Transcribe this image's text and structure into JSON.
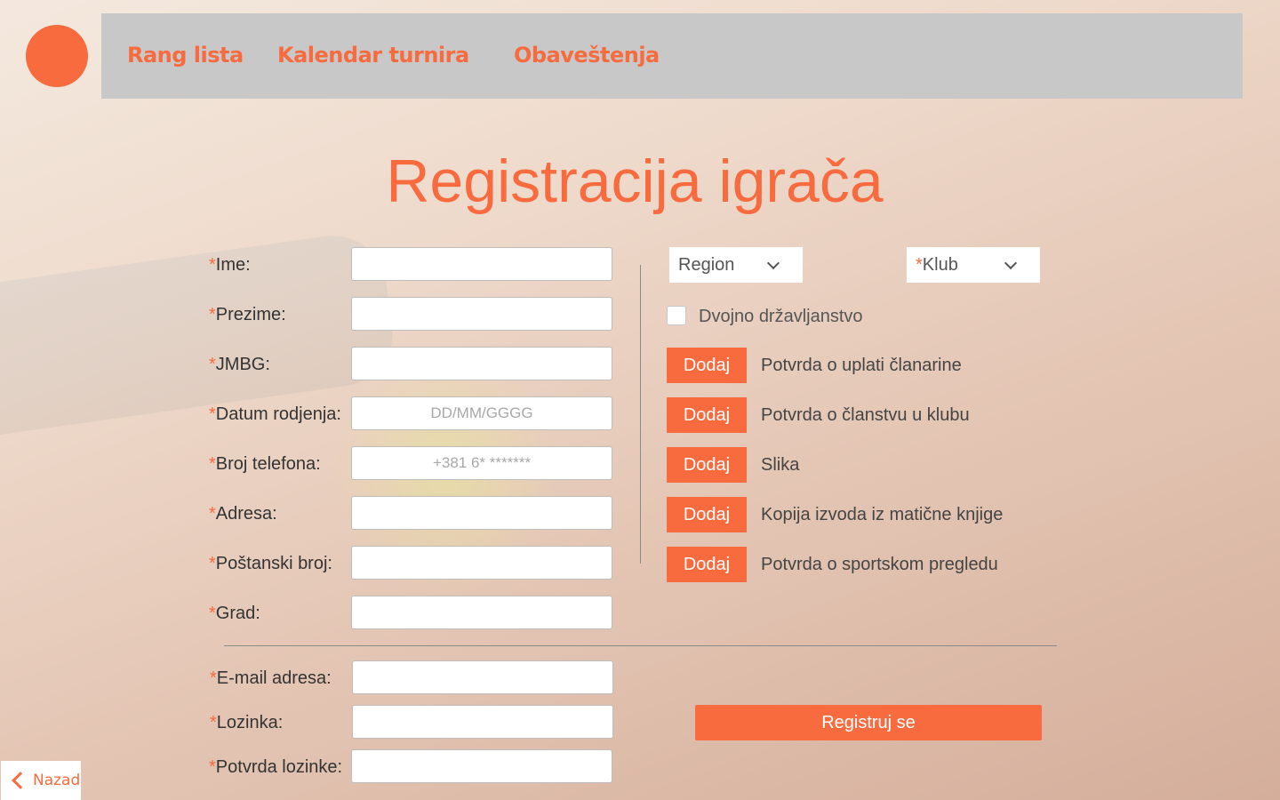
{
  "nav": {
    "items": [
      "Rang lista",
      "Kalendar turnira",
      "Obaveštenja"
    ]
  },
  "page": {
    "title": "Registracija igrača"
  },
  "form": {
    "required_marker": "*",
    "fields": [
      {
        "label": "Ime:",
        "value": "",
        "placeholder": ""
      },
      {
        "label": "Prezime:",
        "value": "",
        "placeholder": ""
      },
      {
        "label": "JMBG:",
        "value": "",
        "placeholder": ""
      },
      {
        "label": "Datum rodjenja:",
        "value": "",
        "placeholder": "DD/MM/GGGG"
      },
      {
        "label": "Broj telefona:",
        "value": "",
        "placeholder": "+381 6* *******"
      },
      {
        "label": "Adresa:",
        "value": "",
        "placeholder": ""
      },
      {
        "label": "Poštanski broj:",
        "value": "",
        "placeholder": ""
      },
      {
        "label": "Grad:",
        "value": "",
        "placeholder": ""
      }
    ],
    "account_fields": [
      {
        "label": "E-mail adresa:",
        "value": "",
        "placeholder": ""
      },
      {
        "label": "Lozinka:",
        "value": "",
        "placeholder": ""
      },
      {
        "label": "Potvrda lozinke:",
        "value": "",
        "placeholder": ""
      }
    ],
    "region_select": {
      "selected": "Region"
    },
    "club_select": {
      "selected": "Klub",
      "required": true
    },
    "dual_citizenship": {
      "label": "Dvojno državljanstvo",
      "checked": false
    },
    "add_button_label": "Dodaj",
    "documents": [
      "Potvrda o uplati članarine",
      "Potvrda o članstvu u klubu",
      "Slika",
      "Kopija izvoda iz matične knjige",
      "Potvrda o sportskom pregledu"
    ],
    "submit_label": "Registruj se"
  },
  "back": {
    "label": "Nazad"
  },
  "colors": {
    "accent": "#f76b3f",
    "nav_bg": "#c8c8c8"
  }
}
